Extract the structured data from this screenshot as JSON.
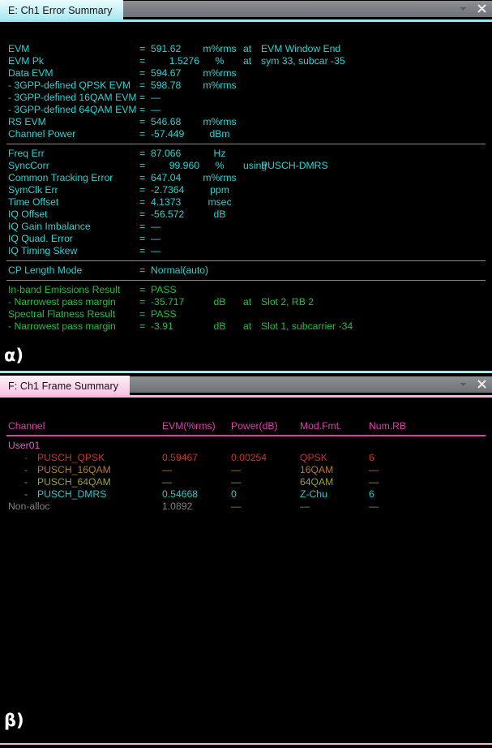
{
  "window": {
    "background": "#000000",
    "accent_cyan": "#27d3d3",
    "accent_green": "#1ec13c",
    "accent_pink": "#e43ab0"
  },
  "panel_error": {
    "tab_label": "E: Ch1 Error Summary",
    "minimize_icon": "chevron-down-icon",
    "close_icon": "close-icon",
    "caption": "α)",
    "groups": [
      {
        "rows": [
          {
            "label": "EVM",
            "eq": "=",
            "value": "591.62",
            "unit": "m%rms",
            "at": "at",
            "extra": "EVM Window End"
          },
          {
            "label": "EVM Pk",
            "eq": "=",
            "value": "1.5276",
            "unit": "%",
            "at": "at",
            "extra": "sym 33,   subcar   -35"
          },
          {
            "label": "Data EVM",
            "eq": "=",
            "value": "594.67",
            "unit": "m%rms",
            "at": "",
            "extra": ""
          },
          {
            "label": " - 3GPP-defined QPSK EVM",
            "eq": "=",
            "value": "598.78",
            "unit": "m%rms",
            "at": "",
            "extra": ""
          },
          {
            "label": " - 3GPP-defined 16QAM EVM",
            "eq": "=",
            "value": "—",
            "unit": "",
            "at": "",
            "extra": ""
          },
          {
            "label": " - 3GPP-defined 64QAM EVM",
            "eq": "=",
            "value": "—",
            "unit": "",
            "at": "",
            "extra": ""
          },
          {
            "label": "RS EVM",
            "eq": "=",
            "value": "546.68",
            "unit": "m%rms",
            "at": "",
            "extra": ""
          },
          {
            "label": "Channel Power",
            "eq": "=",
            "value": "-57.449",
            "unit": "dBm",
            "at": "",
            "extra": ""
          }
        ]
      },
      {
        "rows": [
          {
            "label": "Freq Err",
            "eq": "=",
            "value": "87.066",
            "unit": "Hz",
            "at": "",
            "extra": ""
          },
          {
            "label": "SyncCorr",
            "eq": "=",
            "value": "99.960",
            "unit": "%",
            "at": "using",
            "extra": "PUSCH-DMRS"
          },
          {
            "label": "Common Tracking Error",
            "eq": "=",
            "value": "647.04",
            "unit": "m%rms",
            "at": "",
            "extra": ""
          },
          {
            "label": "SymClk Err",
            "eq": "=",
            "value": "-2.7364",
            "unit": "ppm",
            "at": "",
            "extra": ""
          },
          {
            "label": "Time Offset",
            "eq": "=",
            "value": "4.1373",
            "unit": "msec",
            "at": "",
            "extra": ""
          },
          {
            "label": "IQ Offset",
            "eq": "=",
            "value": "-56.572",
            "unit": "dB",
            "at": "",
            "extra": ""
          },
          {
            "label": "IQ Gain Imbalance",
            "eq": "=",
            "value": "—",
            "unit": "",
            "at": "",
            "extra": ""
          },
          {
            "label": "IQ Quad. Error",
            "eq": "=",
            "value": "—",
            "unit": "",
            "at": "",
            "extra": ""
          },
          {
            "label": "IQ Timing Skew",
            "eq": "=",
            "value": "—",
            "unit": "",
            "at": "",
            "extra": ""
          }
        ]
      },
      {
        "rows": [
          {
            "label": "CP Length Mode",
            "eq": "=",
            "value": "Normal(auto)",
            "unit": "",
            "at": "",
            "extra": ""
          }
        ]
      }
    ],
    "results": [
      {
        "label": "In-band Emissions Result",
        "eq": "=",
        "value": "PASS",
        "unit": "",
        "at": "",
        "extra": ""
      },
      {
        "label": " - Narrowest pass margin",
        "eq": "=",
        "value": "-35.717",
        "unit": "dB",
        "at": "at",
        "extra": "Slot   2,   RB 2"
      },
      {
        "label": "Spectral Flatness Result",
        "eq": "=",
        "value": "PASS",
        "unit": "",
        "at": "",
        "extra": ""
      },
      {
        "label": " - Narrowest pass margin",
        "eq": "=",
        "value": "-3.91",
        "unit": "dB",
        "at": "at",
        "extra": "Slot   1,   subcarrier      -34"
      }
    ]
  },
  "panel_frame": {
    "tab_label": "F: Ch1 Frame Summary",
    "minimize_icon": "chevron-down-icon",
    "close_icon": "close-icon",
    "caption": "β)",
    "columns": [
      "Channel",
      "EVM(%rms)",
      "Power(dB)",
      "Mod.Fmt.",
      "Num.RB"
    ],
    "group_label": "User01",
    "rows": [
      {
        "dash": "-",
        "channel": "PUSCH_QPSK",
        "evm": "0.59467",
        "power": "0.00254",
        "mod": "QPSK",
        "rb": "6",
        "color_key": "u-qpsk"
      },
      {
        "dash": "-",
        "channel": "PUSCH_16QAM",
        "evm": "—",
        "power": "—",
        "mod": "16QAM",
        "rb": "—",
        "color_key": "u-16qam"
      },
      {
        "dash": "-",
        "channel": "PUSCH_64QAM",
        "evm": "—",
        "power": "—",
        "mod": "64QAM",
        "rb": "—",
        "color_key": "u-64qam"
      },
      {
        "dash": "-",
        "channel": "PUSCH_DMRS",
        "evm": "0.54668",
        "power": "0",
        "mod": "Z-Chu",
        "rb": "6",
        "color_key": "u-dmrs"
      }
    ],
    "nonalloc": {
      "dash": "",
      "channel": "Non-alloc",
      "evm": "1.0892",
      "power": "—",
      "mod": "—",
      "rb": "—",
      "color_key": "u-non"
    }
  }
}
